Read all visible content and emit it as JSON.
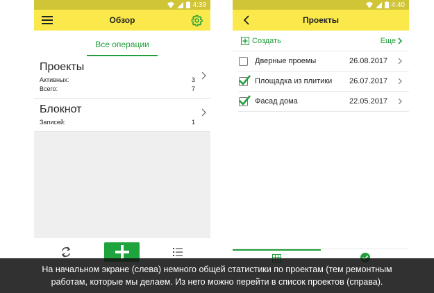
{
  "left_phone": {
    "status_time": "4:39",
    "title": "Обзор",
    "tab_label": "Все операции",
    "cards": [
      {
        "title": "Проекты",
        "rows": [
          {
            "label": "Активных:",
            "value": "3"
          },
          {
            "label": "Всего:",
            "value": "7"
          }
        ]
      },
      {
        "title": "Блокнот",
        "rows": [
          {
            "label": "Записей:",
            "value": "1"
          }
        ]
      }
    ],
    "icons": [
      "menu-icon",
      "settings-gear-icon",
      "chevron-right-icon",
      "sync-icon",
      "plus-icon",
      "list-icon"
    ]
  },
  "right_phone": {
    "status_time": "4:40",
    "title": "Проекты",
    "create_label": "Создать",
    "more_label": "Еще",
    "projects": [
      {
        "name": "Дверные проемы",
        "date": "26.08.2017",
        "checked": false
      },
      {
        "name": "Площадка из плитики",
        "date": "26.07.2017",
        "checked": true
      },
      {
        "name": "Фасад дома",
        "date": "22.05.2017",
        "checked": true
      }
    ],
    "icons": [
      "back-arrow-icon",
      "add-box-icon",
      "chevron-right-icon",
      "grid-icon",
      "check-circle-icon"
    ]
  },
  "caption": {
    "line1": "На начальном экране (слева) немного общей статистики по проектам (тем ремонтным",
    "line2": "работам, которые мы делаем. Из него можно перейти в список проектов (справа)."
  },
  "colors": {
    "status_bar": "#d0c437",
    "app_bar": "#fbe84a",
    "accent_green": "#1f9e3a",
    "content_gray": "#efefef"
  }
}
